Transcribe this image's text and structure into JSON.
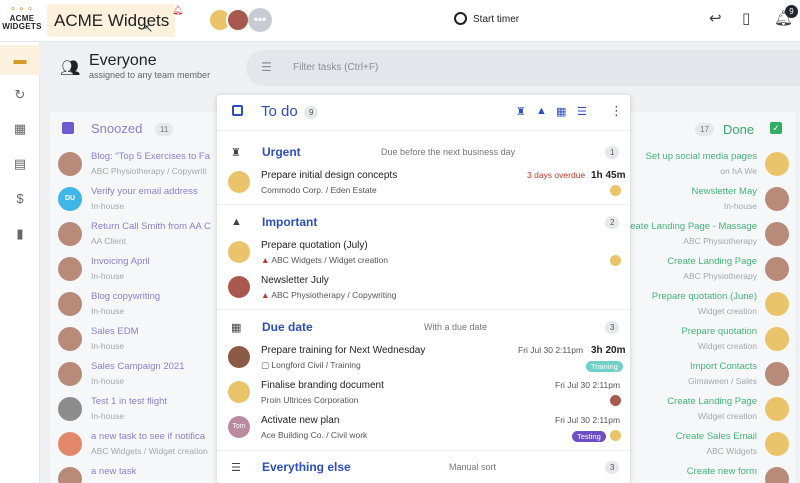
{
  "app": {
    "logo_text": "ACME WIDGETS",
    "org_name": "ACME Widgets",
    "start_timer_label": "Start timer",
    "more_members": "•••",
    "notifications_count": "9"
  },
  "header": {
    "title": "Everyone",
    "subtitle": "assigned to any team member",
    "filter_placeholder": "Filter tasks (Ctrl+F)"
  },
  "snoozed": {
    "label": "Snoozed",
    "count": "11",
    "tasks": [
      {
        "title": "Blog: \"Top 5 Exercises to Fa",
        "sub": "ABC Physiotherapy / Copywriti"
      },
      {
        "title": "Verify your email address",
        "sub": "In-house",
        "initials": "DU"
      },
      {
        "title": "Return Call Smith from AA C",
        "sub": "AA Client"
      },
      {
        "title": "Invoicing April",
        "sub": "In-house"
      },
      {
        "title": "Blog copywriting",
        "sub": "In-house"
      },
      {
        "title": "Sales EDM",
        "sub": "In-house"
      },
      {
        "title": "Sales Campaign 2021",
        "sub": "In-house"
      },
      {
        "title": "Test 1 in test flight",
        "sub": "In-house"
      },
      {
        "title": "a new task to see if notifica",
        "sub": "ABC Widgets / Widget creation"
      },
      {
        "title": "a new task",
        "sub": ""
      }
    ]
  },
  "done": {
    "label": "Done",
    "count": "17",
    "tasks": [
      {
        "title": "Set up social media pages",
        "sub": "on hA We"
      },
      {
        "title": "Newsletter May",
        "sub": "In-house"
      },
      {
        "title": "Create Landing Page - Massage",
        "sub": "ABC Physiotherapy"
      },
      {
        "title": "Create Landing Page",
        "sub": "ABC Physiotherapy"
      },
      {
        "title": "Prepare quotation (June)",
        "sub": "Widget creation"
      },
      {
        "title": "Prepare quotation",
        "sub": "Widget creation"
      },
      {
        "title": "Import Contacts",
        "sub": "Gimaween / Sales"
      },
      {
        "title": "Create Landing Page",
        "sub": "Widget creation"
      },
      {
        "title": "Create Sales Email",
        "sub": "ABC Widgets"
      },
      {
        "title": "Create new form",
        "sub": ""
      }
    ]
  },
  "todo": {
    "label": "To do",
    "count": "9",
    "sections": [
      {
        "title": "Urgent",
        "subtitle": "Due before the next business day",
        "count": "1",
        "tasks": [
          {
            "title": "Prepare initial design concepts",
            "sub": "Commodo Corp. / Eden Estate",
            "meta": "3 days overdue",
            "duration": "1h 45m"
          }
        ]
      },
      {
        "title": "Important",
        "subtitle": "",
        "count": "2",
        "tasks": [
          {
            "title": "Prepare quotation (July)",
            "sub": "ABC Widgets / Widget creation"
          },
          {
            "title": "Newsletter July",
            "sub": "ABC Physiotherapy / Copywriting"
          }
        ]
      },
      {
        "title": "Due date",
        "subtitle": "With a due date",
        "count": "3",
        "tasks": [
          {
            "title": "Prepare training for Next Wednesday",
            "sub": "Longford Civil / Training",
            "meta": "Fri Jul 30 2:11pm",
            "duration": "3h 20m",
            "tag": "Training"
          },
          {
            "title": "Finalise branding document",
            "sub": "Proin Ultrices Corporation",
            "meta": "Fri Jul 30 2:11pm"
          },
          {
            "title": "Activate new plan",
            "sub": "Ace Building Co. / Civil work",
            "meta": "Fri Jul 30 2:11pm",
            "tag": "Testing",
            "initials": "Tom"
          }
        ]
      },
      {
        "title": "Everything else",
        "subtitle": "Manual sort",
        "count": "3",
        "tasks": []
      }
    ]
  },
  "colors": {
    "accent_blue": "#2d4fbe",
    "snoozed_purple": "#8a7fd4",
    "done_green": "#44b57a",
    "org_bg": "#fbf1dd",
    "overdue_red": "#c0392b",
    "tag_training": "#6fd0c9",
    "tag_testing": "#6d4fc4"
  },
  "icons": [
    "bell-icon",
    "timer-icon",
    "back-arrow-icon",
    "bookmark-icon",
    "notification-bell-icon",
    "group-icon",
    "filter-icon",
    "siren-icon",
    "warning-icon",
    "calendar-icon",
    "list-icon",
    "more-vert-icon"
  ]
}
